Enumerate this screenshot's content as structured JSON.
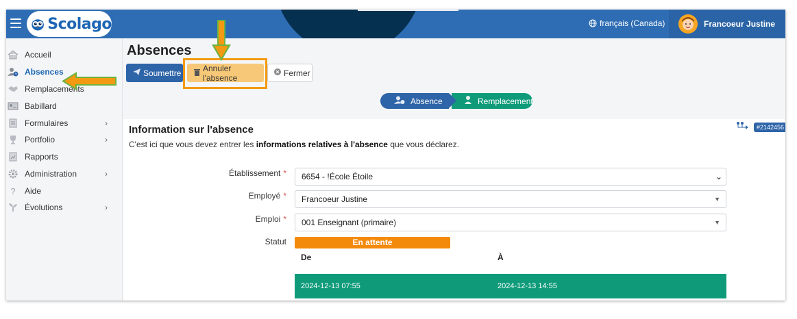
{
  "header": {
    "app_name": "Scolago",
    "language": "français (Canada)",
    "user_name": "Francoeur Justine"
  },
  "sidebar": {
    "items": [
      {
        "label": "Accueil",
        "icon": "home-icon",
        "has_children": false,
        "active": false
      },
      {
        "label": "Absences",
        "icon": "user-clock-icon",
        "has_children": false,
        "active": true
      },
      {
        "label": "Remplacements",
        "icon": "handshake-icon",
        "has_children": false,
        "active": false
      },
      {
        "label": "Babillard",
        "icon": "board-icon",
        "has_children": false,
        "active": false
      },
      {
        "label": "Formulaires",
        "icon": "form-icon",
        "has_children": true,
        "active": false
      },
      {
        "label": "Portfolio",
        "icon": "trophy-icon",
        "has_children": true,
        "active": false
      },
      {
        "label": "Rapports",
        "icon": "report-icon",
        "has_children": false,
        "active": false
      },
      {
        "label": "Administration",
        "icon": "gear-icon",
        "has_children": true,
        "active": false
      },
      {
        "label": "Aide",
        "icon": "question-icon",
        "has_children": false,
        "active": false
      },
      {
        "label": "Évolutions",
        "icon": "sprout-icon",
        "has_children": true,
        "active": false
      }
    ]
  },
  "page": {
    "title": "Absences",
    "toolbar": {
      "submit_label": "Soumettre",
      "cancel_absence_label": "Annuler l'absence",
      "close_label": "Fermer"
    },
    "steps": {
      "step1": "Absence",
      "step2": "Remplacement"
    },
    "section": {
      "title": "Information sur l'absence",
      "desc_before": "C'est ici que vous devez entrer les ",
      "desc_bold": "informations relatives à l'absence",
      "desc_after": " que vous déclarez.",
      "id_badge": "#2142456"
    },
    "form": {
      "etablissement_label": "Établissement",
      "etablissement_value": "6654 - !École Étoile",
      "employe_label": "Employé",
      "employe_value": "Francoeur Justine",
      "emploi_label": "Emploi",
      "emploi_value": "001 Enseignant (primaire)",
      "statut_label": "Statut",
      "statut_value": "En attente",
      "required_mark": "*"
    },
    "table": {
      "col_from": "De",
      "col_to": "À",
      "rows": [
        {
          "from": "2024-12-13 07:55",
          "to": "2024-12-13 14:55"
        }
      ]
    }
  },
  "colors": {
    "header_blue": "#2e6db4",
    "primary": "#2e64a8",
    "success_green": "#0f9b7a",
    "warning_orange": "#f48a0c",
    "annotation_orange": "#f39a12",
    "annotation_green": "#6db33f"
  }
}
